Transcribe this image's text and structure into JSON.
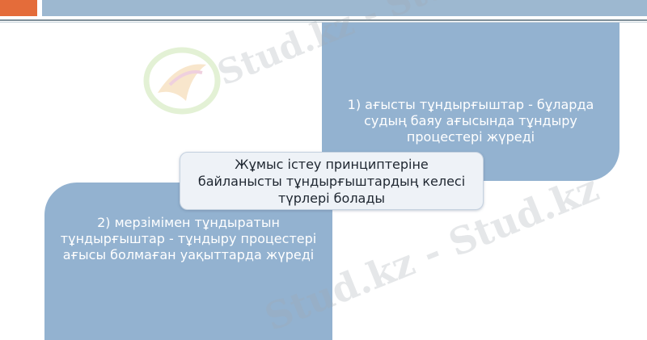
{
  "header": {
    "accent_color": "#e46c3a",
    "bar_color": "#9db8d0"
  },
  "panels": {
    "top_right_text": "1) ағысты тұндырғыштар - бұларда судың баяу ағысында тұндыру процестері жүреді",
    "bottom_left_text": "2) мерзімімен тұндыратын тұндырғыштар - тұндыру процестері ағысы болмаған уақыттарда жүреді",
    "panel_color": "#93b2d0"
  },
  "center": {
    "text": "Жұмыс істеу принциптеріне байланысты тұндырғыштардың келесі түрлері болады"
  },
  "watermark": {
    "text_1": "Stud.kz - Stud",
    "text_2": "Stud.kz - Stud.kz"
  }
}
